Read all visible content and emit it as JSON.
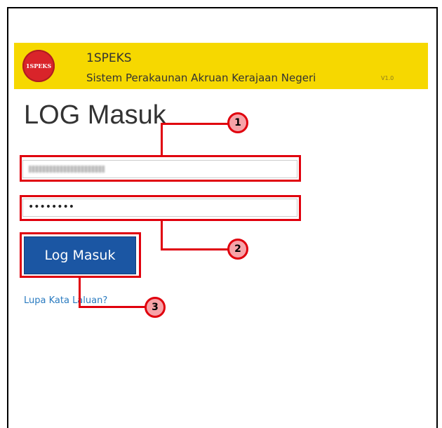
{
  "header": {
    "logo_text": "1SPEKS",
    "app_name": "1SPEKS",
    "app_description": "Sistem Perakaunan Akruan Kerajaan Negeri",
    "version": "V1.0",
    "background_color": "#f6d800"
  },
  "login": {
    "title": "LOG Masuk",
    "username_value": "",
    "password_value": "••••••••",
    "login_button_label": "Log Masuk",
    "forgot_password_link": "Lupa Kata Laluan?",
    "button_color": "#1b56a3",
    "link_color": "#2a7bc0"
  },
  "annotations": {
    "color": "#e0000d",
    "callouts": [
      {
        "number": "1",
        "target": "username-field"
      },
      {
        "number": "2",
        "target": "password-field"
      },
      {
        "number": "3",
        "target": "login-button"
      }
    ]
  }
}
